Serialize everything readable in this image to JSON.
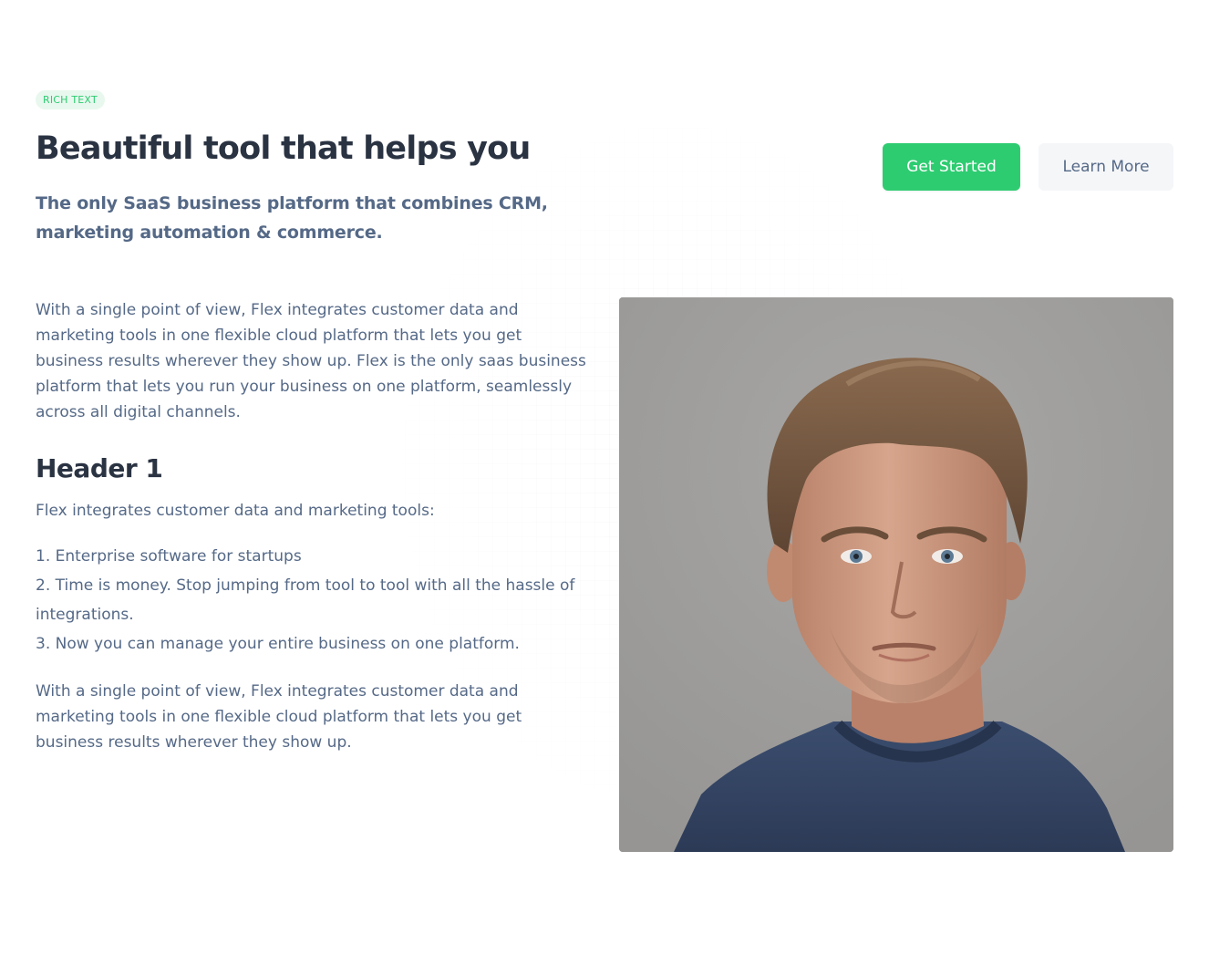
{
  "badge": "RICH TEXT",
  "title": "Beautiful tool that helps you",
  "subtitle": "The only SaaS business platform that combines CRM, marketing automation & commerce.",
  "buttons": {
    "primary_label": "Get Started",
    "secondary_label": "Learn More"
  },
  "content": {
    "paragraph1": "With a single point of view, Flex integrates customer data and marketing tools in one flexible cloud platform that lets you get business results wherever they show up. Flex is the only saas business platform that lets you run your business on one platform, seamlessly across all digital channels.",
    "heading": "Header 1",
    "paragraph2": "Flex integrates customer data and marketing tools:",
    "list": [
      "1. Enterprise software for startups",
      "2. Time is money. Stop jumping from tool to tool with all the hassle of integrations.",
      "3. Now you can manage your entire business on one platform."
    ],
    "paragraph3": "With a single point of view, Flex integrates customer data and marketing tools in one flexible cloud platform that lets you get business results wherever they show up."
  },
  "colors": {
    "accent": "#2ecc71",
    "heading": "#2a3342",
    "body_text": "#556987",
    "secondary_button_bg": "#f5f6f8"
  },
  "image": {
    "subject": "portrait of a man with tousled brown hair wearing a navy sweater"
  }
}
